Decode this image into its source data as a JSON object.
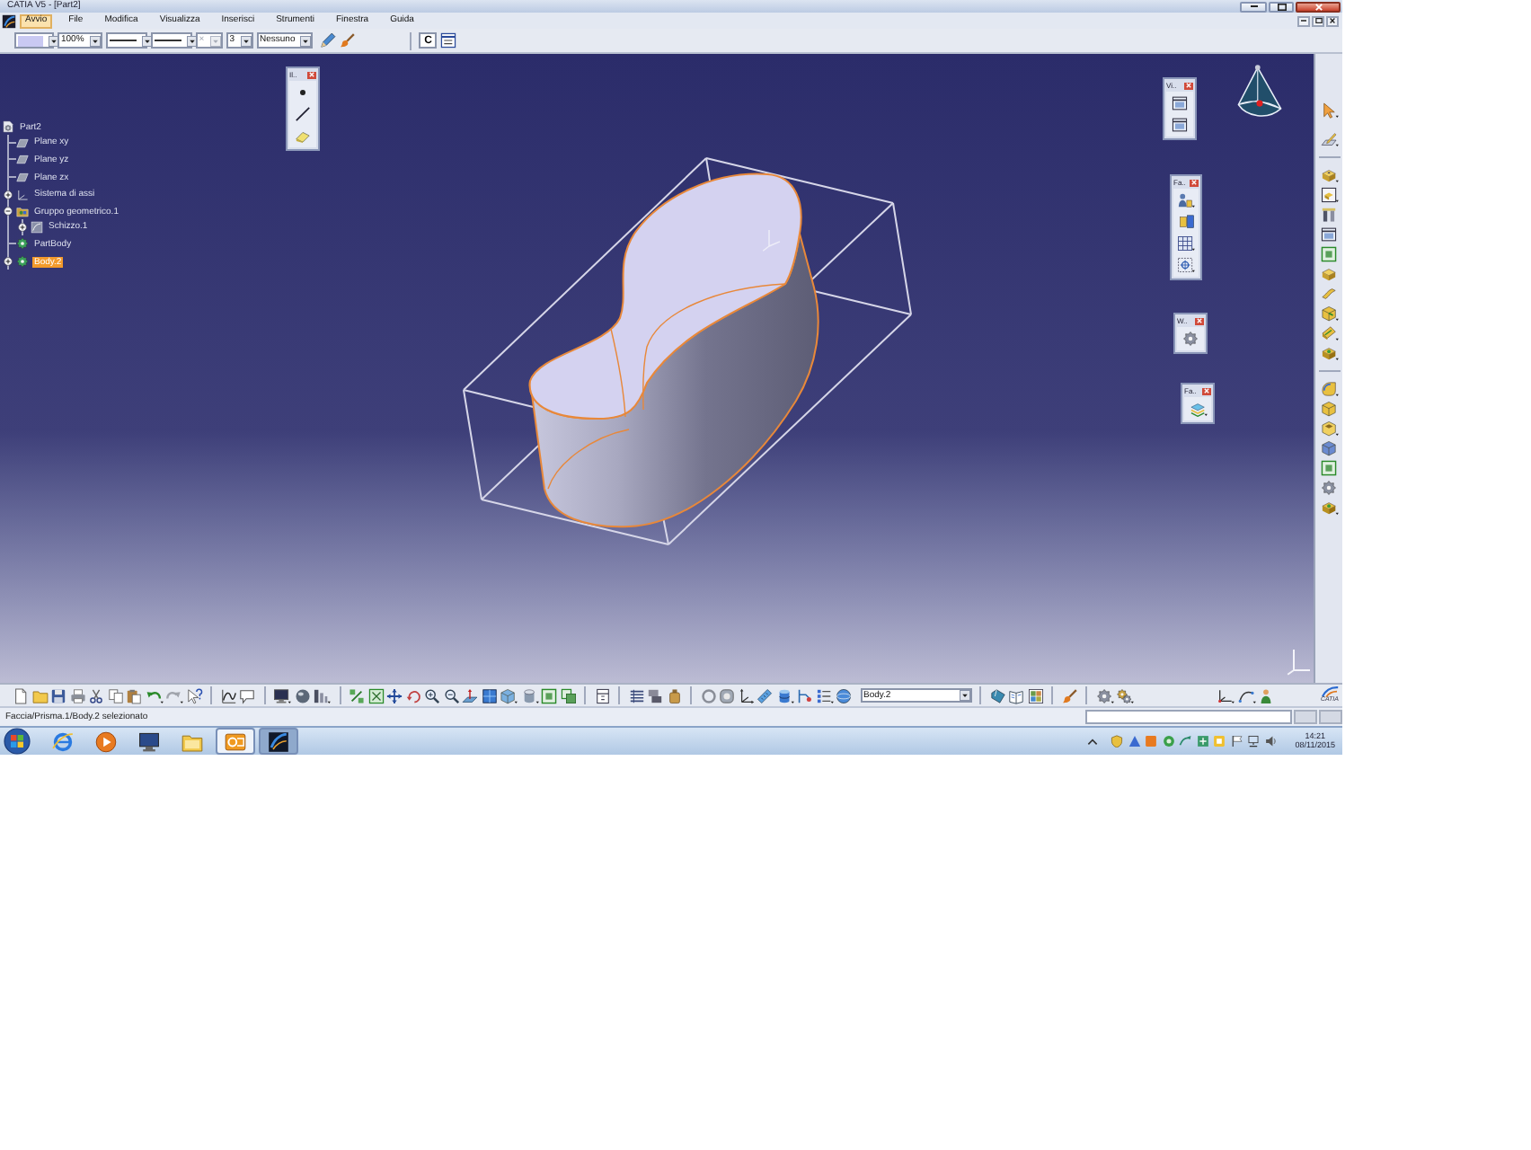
{
  "window": {
    "title": "CATIA V5 - [Part2]"
  },
  "menu_bar": [
    {
      "label": "Avvio",
      "selected": true
    },
    {
      "label": "File",
      "selected": false
    },
    {
      "label": "Modifica",
      "selected": false
    },
    {
      "label": "Visualizza",
      "selected": false
    },
    {
      "label": "Inserisci",
      "selected": false
    },
    {
      "label": "Strumenti",
      "selected": false
    },
    {
      "label": "Finestra",
      "selected": false
    },
    {
      "label": "Guida",
      "selected": false
    }
  ],
  "graphic_properties_toolbar": {
    "dropdowns": [
      {
        "kind": "swatch",
        "color": "#c9c9f2",
        "disabled": false
      },
      {
        "kind": "text",
        "value": "100%",
        "disabled": false
      },
      {
        "kind": "line",
        "disabled": false
      },
      {
        "kind": "line",
        "disabled": false
      },
      {
        "kind": "text",
        "value": "×",
        "disabled": true
      },
      {
        "kind": "text",
        "value": "3",
        "disabled": false
      },
      {
        "kind": "text",
        "value": "Nessuno",
        "disabled": false
      }
    ],
    "button": "C"
  },
  "tree": [
    {
      "label": "Part2",
      "kind": "part",
      "selected": false,
      "children": [
        {
          "label": "Plane xy",
          "kind": "plane",
          "selected": false
        },
        {
          "label": "Plane yz",
          "kind": "plane",
          "selected": false
        },
        {
          "label": "Plane zx",
          "kind": "plane",
          "selected": false
        },
        {
          "label": "Sistema di assi",
          "kind": "axis_system",
          "selected": false,
          "expanded": false
        },
        {
          "label": "Gruppo geometrico.1",
          "kind": "geometric_set",
          "selected": false,
          "expanded": true,
          "children": [
            {
              "label": "Schizzo.1",
              "kind": "sketch",
              "selected": false,
              "expanded": false
            }
          ]
        },
        {
          "label": "PartBody",
          "kind": "body",
          "selected": false
        },
        {
          "label": "Body.2",
          "kind": "body",
          "selected": true,
          "expanded": false
        }
      ]
    }
  ],
  "floating_toolbars": [
    {
      "title": "Il.."
    },
    {
      "title": "Vi.."
    },
    {
      "title": "Fa.."
    },
    {
      "title": "W.."
    },
    {
      "title": "Fa.."
    }
  ],
  "bottom_toolbar": {
    "current_body": "Body.2",
    "logo_text": "CATIA"
  },
  "status_bar": {
    "message": "Faccia/Prisma.1/Body.2 selezionato"
  },
  "taskbar": {
    "buttons": [
      {
        "kind": "browser",
        "running": false,
        "selected": false
      },
      {
        "kind": "media_player",
        "running": false,
        "selected": false
      },
      {
        "kind": "desktop",
        "running": false,
        "selected": false
      },
      {
        "kind": "folder",
        "running": false,
        "selected": false
      },
      {
        "kind": "mail",
        "running": true,
        "selected": false
      },
      {
        "kind": "cad",
        "running": true,
        "selected": true
      }
    ],
    "time": "14:21",
    "date": "08/11/2015"
  }
}
